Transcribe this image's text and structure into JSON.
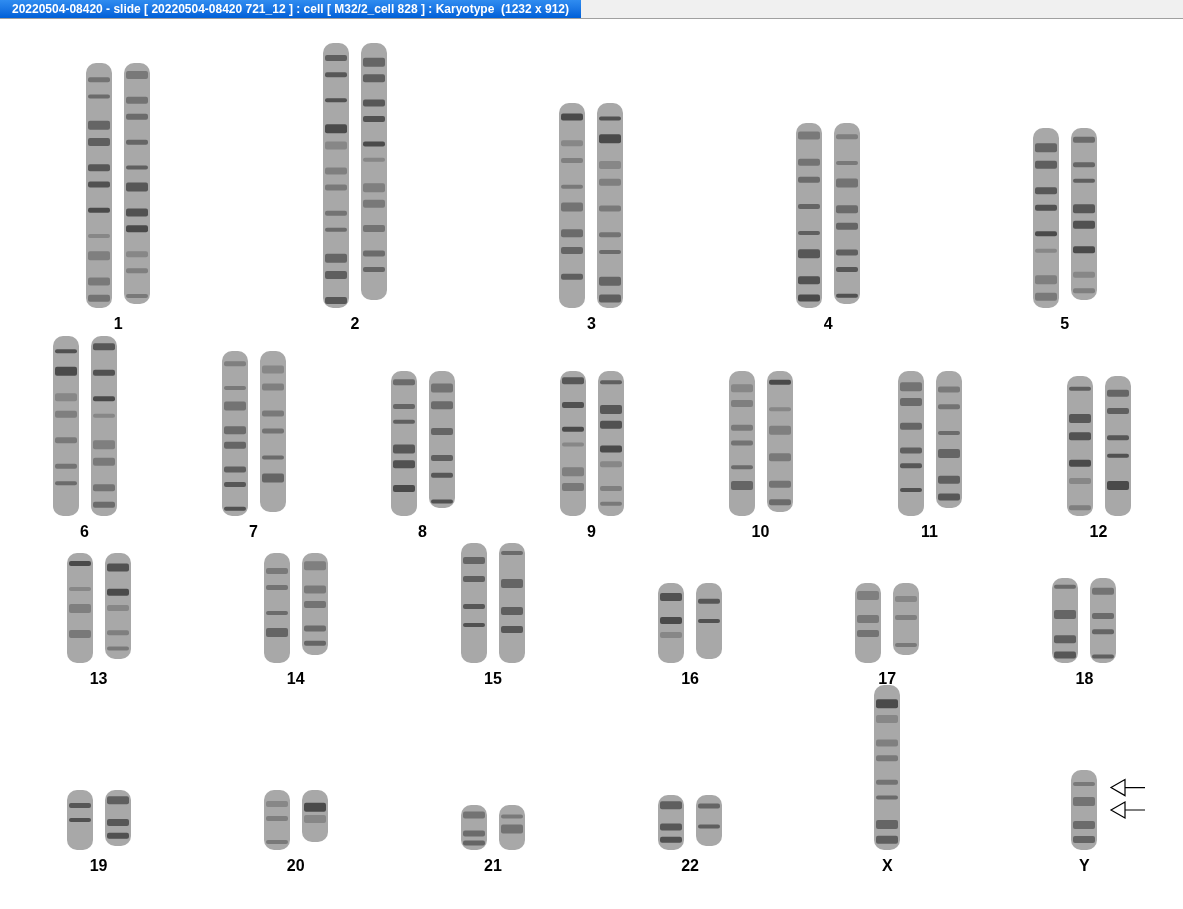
{
  "window": {
    "title": "20220504-08420 - slide [ 20220504-08420 721_12 ] : cell [ M32/2_cell 828 ] : Karyotype  (1232 x 912)"
  },
  "karyotype_rows": [
    {
      "items": [
        {
          "label": "1",
          "kind": "pair",
          "marked": false
        },
        {
          "label": "2",
          "kind": "pair",
          "marked": false
        },
        {
          "label": "3",
          "kind": "pair",
          "marked": false
        },
        {
          "label": "4",
          "kind": "pair",
          "marked": false
        },
        {
          "label": "5",
          "kind": "pair",
          "marked": false
        }
      ]
    },
    {
      "items": [
        {
          "label": "6",
          "kind": "pair",
          "marked": false
        },
        {
          "label": "7",
          "kind": "pair",
          "marked": false
        },
        {
          "label": "8",
          "kind": "pair",
          "marked": false
        },
        {
          "label": "9",
          "kind": "pair",
          "marked": false
        },
        {
          "label": "10",
          "kind": "pair",
          "marked": false
        },
        {
          "label": "11",
          "kind": "pair",
          "marked": false
        },
        {
          "label": "12",
          "kind": "pair",
          "marked": false
        }
      ]
    },
    {
      "items": [
        {
          "label": "13",
          "kind": "pair",
          "marked": false
        },
        {
          "label": "14",
          "kind": "pair",
          "marked": false
        },
        {
          "label": "15",
          "kind": "pair",
          "marked": false
        },
        {
          "label": "16",
          "kind": "pair",
          "marked": false
        },
        {
          "label": "17",
          "kind": "pair",
          "marked": false
        },
        {
          "label": "18",
          "kind": "pair",
          "marked": false
        }
      ]
    },
    {
      "items": [
        {
          "label": "19",
          "kind": "pair",
          "marked": false
        },
        {
          "label": "20",
          "kind": "pair",
          "marked": false
        },
        {
          "label": "21",
          "kind": "pair",
          "marked": false
        },
        {
          "label": "22",
          "kind": "pair",
          "marked": false
        },
        {
          "label": "X",
          "kind": "single",
          "marked": false
        },
        {
          "label": "Y",
          "kind": "single",
          "marked": true
        }
      ]
    }
  ]
}
